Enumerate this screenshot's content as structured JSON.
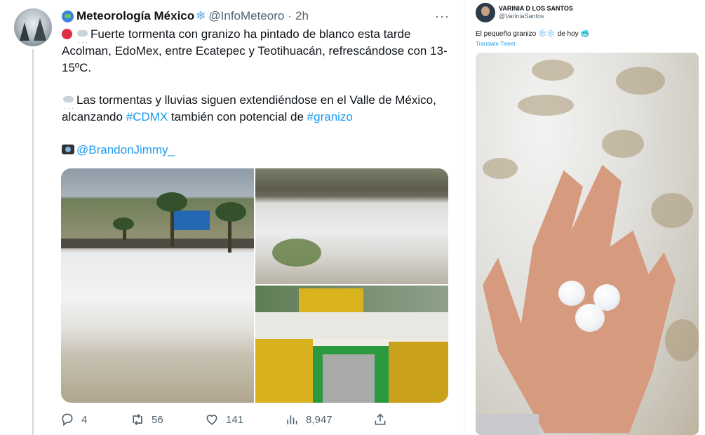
{
  "main_tweet": {
    "display_name": "Meteorología México",
    "name_emoji": "❄",
    "handle": "@InfoMeteoro",
    "separator": "·",
    "time": "2h",
    "more": "···",
    "paragraph1": "Fuerte tormenta con granizo ha pintado de blanco esta tarde Acolman, EdoMex, entre Ecatepec y Teotihuacán, refrescándose con 13-15ºC.",
    "paragraph2_a": "Las tormentas y lluvias siguen extendiéndose en el Valle de México, alcanzando ",
    "hashtag1": "#CDMX",
    "paragraph2_b": " también con potencial de ",
    "hashtag2": "#granizo",
    "credit": "@BrandonJimmy_",
    "icons": {
      "status": "red-circle-icon",
      "weather": "cloud-hail-icon",
      "storm": "cloud-lightning-icon",
      "camera": "camera-flash-icon"
    },
    "stats": {
      "replies": "4",
      "retweets": "56",
      "likes": "141",
      "views": "8,947"
    }
  },
  "side_tweet": {
    "display_name": "VARINIA D LOS SANTOS",
    "handle": "@VariniaSantos",
    "text": "El pequeño granizo ❄️❄️ de hoy 🥶",
    "translate": "Translate Tweet"
  },
  "colors": {
    "link": "#1d9bf0",
    "text": "#0f1419",
    "muted": "#536471"
  }
}
